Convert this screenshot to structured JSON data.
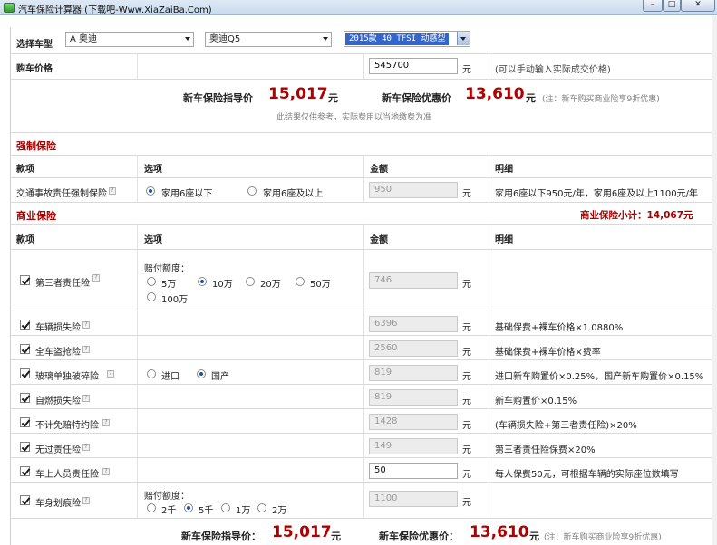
{
  "window": {
    "title": "汽车保险计算器 (下载吧-Www.XiaZaiBa.Com)",
    "min": "–",
    "max": "□",
    "close": "✕"
  },
  "car": {
    "label": "选择车型",
    "brand": "A 奥迪",
    "series": "奥迪Q5",
    "model": "2015款 40 TFSI 动感型",
    "price_label": "购车价格",
    "price_value": "545700",
    "price_unit": "元",
    "price_note": "(可以手动输入实际成交价格)"
  },
  "summary_top": {
    "guide_label": "新车保险指导价",
    "guide_value": "15,017",
    "guide_unit": "元",
    "discount_label": "新车保险优惠价",
    "discount_value": "13,610",
    "discount_unit": "元",
    "discount_note": "(注：新车购买商业险享9折优惠)",
    "disclaimer": "此结果仅供参考，实际费用以当地缴费为准"
  },
  "compulsory": {
    "title": "强制保险",
    "headers": [
      "款项",
      "选项",
      "金额",
      "明细"
    ],
    "row": {
      "name": "交通事故责任强制保险",
      "opt1": "家用6座以下",
      "opt2": "家用6座及以上",
      "amount": "950",
      "unit": "元",
      "detail": "家用6座以下950元/年，家用6座及以上1100元/年"
    }
  },
  "commercial": {
    "title": "商业保险",
    "subtotal": "商业保险小计：14,067元",
    "headers": [
      "款项",
      "选项",
      "金额",
      "明细"
    ],
    "third_party": {
      "name": "第三者责任险",
      "limit_label": "赔付额度：",
      "options": [
        "5万",
        "10万",
        "20万",
        "50万",
        "100万"
      ],
      "amount": "746",
      "unit": "元"
    },
    "rows": [
      {
        "name": "车辆损失险",
        "amount": "6396",
        "unit": "元",
        "detail": "基础保费+裸车价格×1.0880%"
      },
      {
        "name": "全车盗抢险",
        "amount": "2560",
        "unit": "元",
        "detail": "基础保费+裸车价格×费率"
      },
      {
        "name": "玻璃单独破碎险",
        "opt1": "进口",
        "opt2": "国产",
        "amount": "819",
        "unit": "元",
        "detail": "进口新车购置价×0.25%，国产新车购置价×0.15%"
      },
      {
        "name": "自燃损失险",
        "amount": "819",
        "unit": "元",
        "detail": "新车购置价×0.15%"
      },
      {
        "name": "不计免赔特约险",
        "amount": "1428",
        "unit": "元",
        "detail": "(车辆损失险+第三者责任险)×20%"
      },
      {
        "name": "无过责任险",
        "amount": "149",
        "unit": "元",
        "detail": "第三者责任险保费×20%"
      },
      {
        "name": "车上人员责任险",
        "amount": "50",
        "unit": "元",
        "detail": "每人保费50元，可根据车辆的实际座位数填写"
      }
    ],
    "scratch": {
      "name": "车身划痕险",
      "limit_label": "赔付额度：",
      "options": [
        "2千",
        "5千",
        "1万",
        "2万"
      ],
      "amount": "1100",
      "unit": "元"
    }
  },
  "summary_bottom": {
    "guide_label": "新车保险指导价：",
    "guide_value": "15,017",
    "guide_unit": "元",
    "discount_label": "新车保险优惠价：",
    "discount_value": "13,610",
    "discount_unit": "元",
    "discount_note": "(注：新车购买商业险享9折优惠)"
  }
}
